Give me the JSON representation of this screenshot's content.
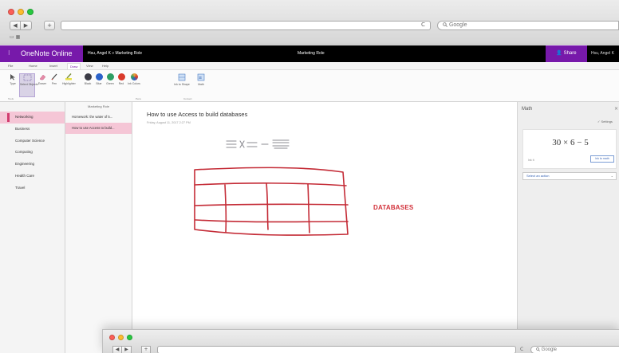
{
  "browser": {
    "search_placeholder": "Google",
    "reload_glyph": "C",
    "back_glyph": "◀",
    "forward_glyph": "▶",
    "newtab_glyph": "+",
    "bookmarks_glyph": "▭ ▦",
    "search_icon": "magnifier-icon"
  },
  "onenote": {
    "brand": "OneNote Online",
    "user_notebook": "Hsu, Angel K » Marketing Role",
    "page_center_title": "Marketing Role",
    "share_label": "Share",
    "user_name": "Hsu, Angel K",
    "brand_color": "#7719aa"
  },
  "ribbon": {
    "tabs": [
      "File",
      "Home",
      "Insert",
      "Draw",
      "View",
      "Help"
    ],
    "active_tab": "Draw",
    "tools": [
      {
        "label": "Type",
        "icon": "cursor-icon"
      },
      {
        "label": "Select Objects",
        "icon": "lasso-icon"
      },
      {
        "label": "Eraser",
        "icon": "eraser-icon"
      },
      {
        "label": "Pen",
        "icon": "pen-icon"
      },
      {
        "label": "Highlighter",
        "icon": "highlighter-icon"
      }
    ],
    "colors": [
      {
        "label": "Black",
        "color": "#3c3c46"
      },
      {
        "label": "Blue",
        "color": "#2b62c9"
      },
      {
        "label": "Green",
        "color": "#2e9e63"
      },
      {
        "label": "Red",
        "color": "#d93a2b"
      },
      {
        "label": "Ink Colors",
        "color": "#e8a33c"
      }
    ],
    "extra_tools": [
      {
        "label": "Ink to Shape",
        "icon": "shapes-icon"
      },
      {
        "label": "Math",
        "icon": "math-icon"
      }
    ],
    "group_labels": [
      "Tools",
      "Pens",
      "Convert"
    ]
  },
  "sections": {
    "header": "",
    "items": [
      "Networking",
      "Business",
      "Computer Science",
      "Computing",
      "Engineering",
      "Health Care",
      "Travel"
    ],
    "selected_index": 0
  },
  "pages": {
    "header": "Marketing Role",
    "items": [
      "Homework: the water of 5...",
      "How to use Access to build..."
    ],
    "selected_index": 1
  },
  "page": {
    "title": "How to use Access to build databases",
    "date": "Friday, August 11, 2017   2:27 PM",
    "ink_label": "DATABASES",
    "ink_color": "#c42b36"
  },
  "math": {
    "title": "Math",
    "close_glyph": "×",
    "settings": "✓ Settings",
    "expression": "30 × 6 − 5",
    "ink_caption": "Ink It",
    "ink_button": "Ink to math",
    "select_action": "Select an action",
    "caret": "⌄"
  },
  "browser2": {
    "search_placeholder": "Google",
    "reload_glyph": "C",
    "back_glyph": "◀",
    "forward_glyph": "▶",
    "newtab_glyph": "+"
  }
}
